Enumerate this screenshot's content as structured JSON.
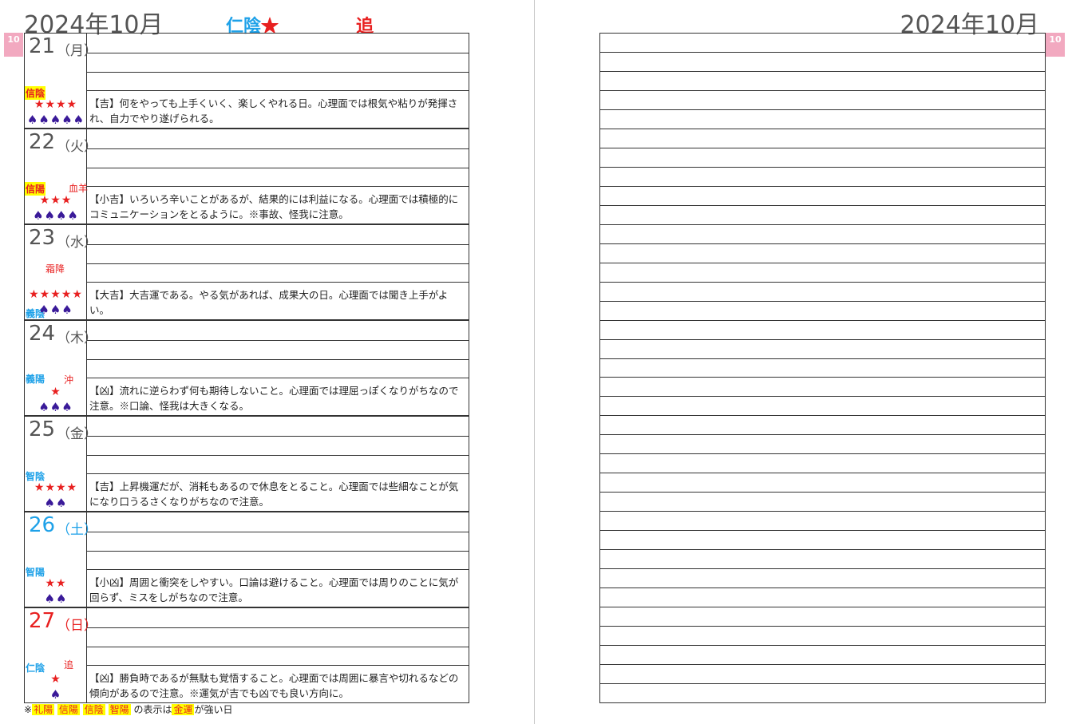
{
  "header": {
    "left_title": "2024年10月",
    "right_title": "2024年10月",
    "fortune_label": "仁陰",
    "fortune_star": "★",
    "extra": "追",
    "month_tab": "10"
  },
  "colors": {
    "accent_blue": "#1ea1e8",
    "accent_red": "#e82020",
    "highlight": "#ffff00",
    "spade": "#3a1a99",
    "tab_pink": "#f2a9c0"
  },
  "days": [
    {
      "date": "21",
      "weekday": "（月）",
      "badge": "信陰",
      "badge_highlight": true,
      "extra": "",
      "stars": "★★★★",
      "spades": "♠♠♠♠♠",
      "text": "【吉】何をやっても上手くいく、楽しくやれる日。心理面では根気や粘りが発揮され、自力でやり遂げられる。"
    },
    {
      "date": "22",
      "weekday": "（火）",
      "badge": "信陽",
      "badge_highlight": true,
      "extra": "血羊",
      "stars": "★★★",
      "spades": "♠♠♠♠",
      "text": "【小吉】いろいろ辛いことがあるが、結果的には利益になる。心理面では積極的にコミュニケーションをとるように。※事故、怪我に注意。"
    },
    {
      "date": "23",
      "weekday": "（水）",
      "badge": "義陰",
      "badge_highlight": false,
      "extra": "霜降",
      "stars": "★★★★★",
      "spades": "♠♠♠",
      "text": "【大吉】大吉運である。やる気があれば、成果大の日。心理面では聞き上手がよい。"
    },
    {
      "date": "24",
      "weekday": "（木）",
      "badge": "義陽",
      "badge_highlight": false,
      "extra": "沖",
      "stars": "★",
      "spades": "♠♠♠",
      "text": "【凶】流れに逆らわず何も期待しないこと。心理面では理屈っぽくなりがちなので注意。※口論、怪我は大きくなる。"
    },
    {
      "date": "25",
      "weekday": "（金）",
      "badge": "智陰",
      "badge_highlight": false,
      "extra": "",
      "stars": "★★★★",
      "spades": "♠♠",
      "text": "【吉】上昇機運だが、消耗もあるので休息をとること。心理面では些細なことが気になり口うるさくなりがちなので注意。"
    },
    {
      "date": "26",
      "weekday": "（土）",
      "badge": "智陽",
      "badge_highlight": false,
      "extra": "",
      "stars": "★★",
      "spades": "♠♠",
      "text": "【小凶】周囲と衝突をしやすい。口論は避けること。心理面では周りのことに気が回らず、ミスをしがちなので注意。"
    },
    {
      "date": "27",
      "weekday": "（日）",
      "badge": "仁陰",
      "badge_highlight": false,
      "extra": "追",
      "stars": "★",
      "spades": "♠",
      "text": "【凶】勝負時であるが無駄も覚悟すること。心理面では周囲に暴言や切れるなどの傾向があるので注意。※運気が吉でも凶でも良い方向に。"
    }
  ],
  "footer": {
    "prefix": "※",
    "items": [
      "礼陽",
      "信陽",
      "信陰",
      "智陽"
    ],
    "middle": "の表示は",
    "keyword": "金運",
    "suffix": "が強い日"
  }
}
